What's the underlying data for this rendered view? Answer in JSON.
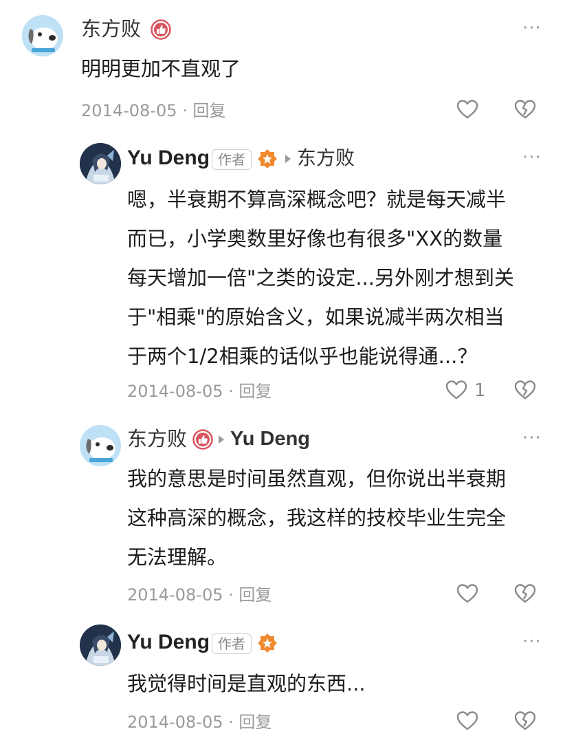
{
  "comments": [
    {
      "author": "东方败",
      "text_lines": [
        "明明更加不直观了"
      ],
      "date": "2014-08-05",
      "sep": "·",
      "reply_label": "回复",
      "more": "···"
    },
    {
      "author": "Yu Deng",
      "author_tag": "作者",
      "reply_to": "东方败",
      "text_lines": [
        "嗯，半衰期不算高深概念吧？就是每天减半",
        "而已，小学奥数里好像也有很多\"XX的数量",
        "每天增加一倍\"之类的设定...另外刚才想到关",
        "于\"相乘\"的原始含义，如果说减半两次相当",
        "于两个1/2相乘的话似乎也能说得通...？"
      ],
      "date": "2014-08-05",
      "sep": "·",
      "reply_label": "回复",
      "like_count": "1",
      "more": "···"
    },
    {
      "author": "东方败",
      "reply_to": "Yu Deng",
      "text_lines": [
        "我的意思是时间虽然直观，但你说出半衰期",
        "这种高深的概念，我这样的技校毕业生完全",
        "无法理解。"
      ],
      "date": "2014-08-05",
      "sep": "·",
      "reply_label": "回复",
      "more": "···"
    },
    {
      "author": "Yu Deng",
      "author_tag": "作者",
      "text_lines": [
        "我觉得时间是直观的东西..."
      ],
      "date": "2014-08-05",
      "sep": "·",
      "reply_label": "回复",
      "more": "···"
    }
  ],
  "colors": {
    "badge_red": "#d9545f",
    "badge_orange": "#f08a2e",
    "icon_gray": "#8a8a8a"
  },
  "icons": [
    "avatar-dog",
    "avatar-anime",
    "thumb-badge-icon",
    "medal-badge-icon",
    "heart-icon",
    "broken-heart-icon",
    "more-icon",
    "reply-arrow-icon"
  ]
}
